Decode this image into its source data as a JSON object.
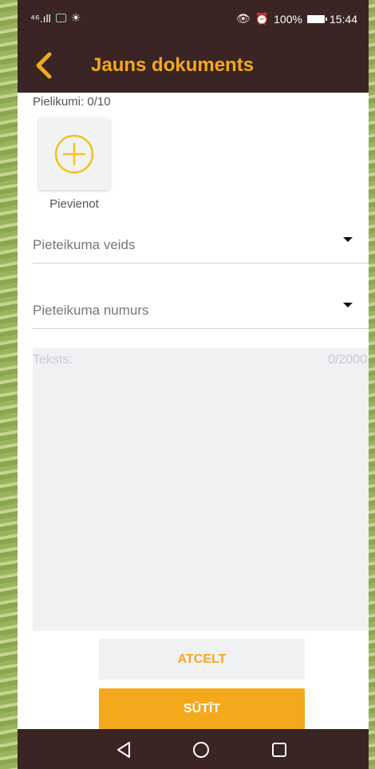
{
  "status_bar": {
    "signal": "⁴⁶.ıll",
    "time": "15:44",
    "battery_percent": "100%",
    "icons": [
      "signal-icon",
      "notification-icon",
      "brightness-icon",
      "eye-icon",
      "alarm-icon",
      "battery-icon"
    ]
  },
  "header": {
    "title": "Jauns dokuments",
    "back_icon": "chevron-left-icon"
  },
  "attachments": {
    "label": "Pielikumi: 0/10",
    "add_label": "Pievienot",
    "add_icon": "plus-circle-icon"
  },
  "form": {
    "type_placeholder": "Pieteikuma veids",
    "number_placeholder": "Pieteikuma numurs",
    "text_placeholder": "Teksts:",
    "text_counter": "0/2000"
  },
  "buttons": {
    "cancel_label": "ATCELT",
    "send_label": "SŪTĪT"
  },
  "nav": [
    "back-triangle-icon",
    "home-circle-icon",
    "recents-square-icon"
  ],
  "colors": {
    "accent": "#f4a81c",
    "bar": "#3a2424",
    "field_bg": "#f0f1f3"
  }
}
